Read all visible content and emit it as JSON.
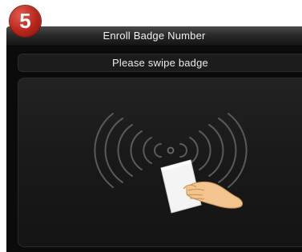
{
  "step": {
    "number": "5",
    "color": "#b8261c"
  },
  "header": {
    "title": "Enroll Badge Number"
  },
  "prompt": {
    "text": "Please swipe badge"
  },
  "illustration": {
    "icon": "swipe-badge-icon"
  }
}
